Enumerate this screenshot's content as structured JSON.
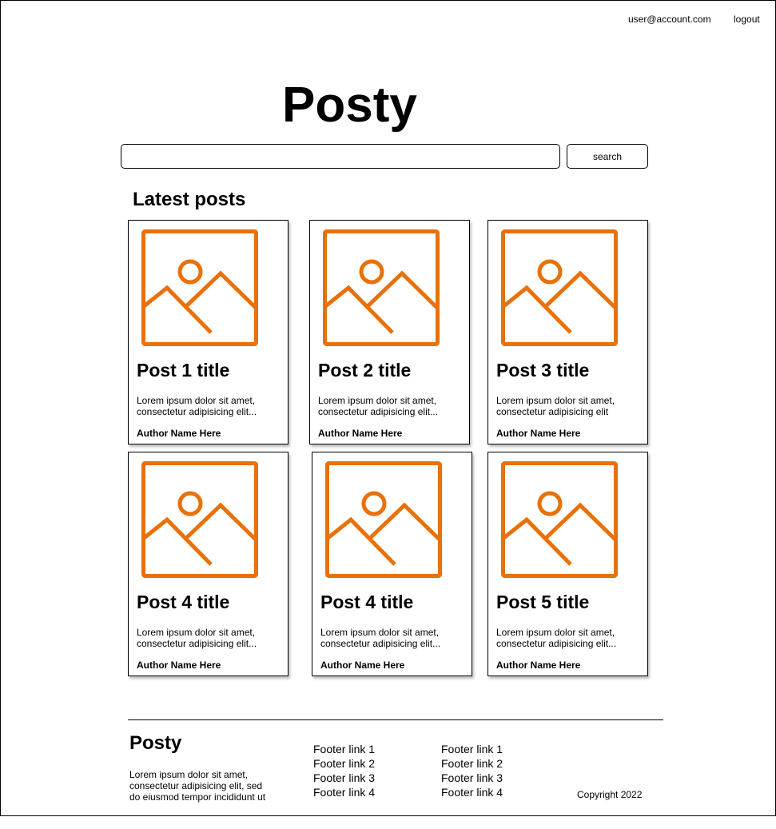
{
  "header": {
    "user_email": "user@account.com",
    "logout_label": "logout"
  },
  "brand": {
    "logo": "Posty"
  },
  "search": {
    "value": "",
    "placeholder": "",
    "button_label": "search"
  },
  "latest": {
    "heading": "Latest posts",
    "posts": [
      {
        "title": "Post 1 title",
        "excerpt": "Lorem ipsum dolor sit amet, consectetur adipisicing elit...",
        "author": "Author Name Here",
        "image_icon": "image-placeholder-icon"
      },
      {
        "title": "Post 2 title",
        "excerpt": "Lorem ipsum dolor sit amet, consectetur adipisicing elit...",
        "author": "Author Name Here",
        "image_icon": "image-placeholder-icon"
      },
      {
        "title": "Post 3 title",
        "excerpt": "Lorem ipsum dolor sit amet, consectetur adipisicing elit",
        "author": "Author Name Here",
        "image_icon": "image-placeholder-icon"
      },
      {
        "title": "Post 4 title",
        "excerpt": "Lorem ipsum dolor sit amet, consectetur adipisicing elit...",
        "author": "Author Name Here",
        "image_icon": "image-placeholder-icon"
      },
      {
        "title": "Post 4 title",
        "excerpt": "Lorem ipsum dolor sit amet, consectetur adipisicing elit...",
        "author": "Author Name Here",
        "image_icon": "image-placeholder-icon"
      },
      {
        "title": "Post 5 title",
        "excerpt": "Lorem ipsum dolor sit amet, consectetur adipisicing elit...",
        "author": "Author Name Here",
        "image_icon": "image-placeholder-icon"
      }
    ]
  },
  "footer": {
    "logo": "Posty",
    "text": "Lorem ipsum dolor sit amet, consectetur adipisicing elit, sed do eiusmod tempor incididunt ut",
    "links_col1": [
      "Footer link 1",
      "Footer link 2",
      "Footer link 3",
      "Footer link 4"
    ],
    "links_col2": [
      "Footer link 1",
      "Footer link 2",
      "Footer link 3",
      "Footer link 4"
    ],
    "copyright": "Copyright 2022"
  },
  "colors": {
    "accent": "#E8710A",
    "border": "#000000",
    "background": "#FFFFFF"
  }
}
